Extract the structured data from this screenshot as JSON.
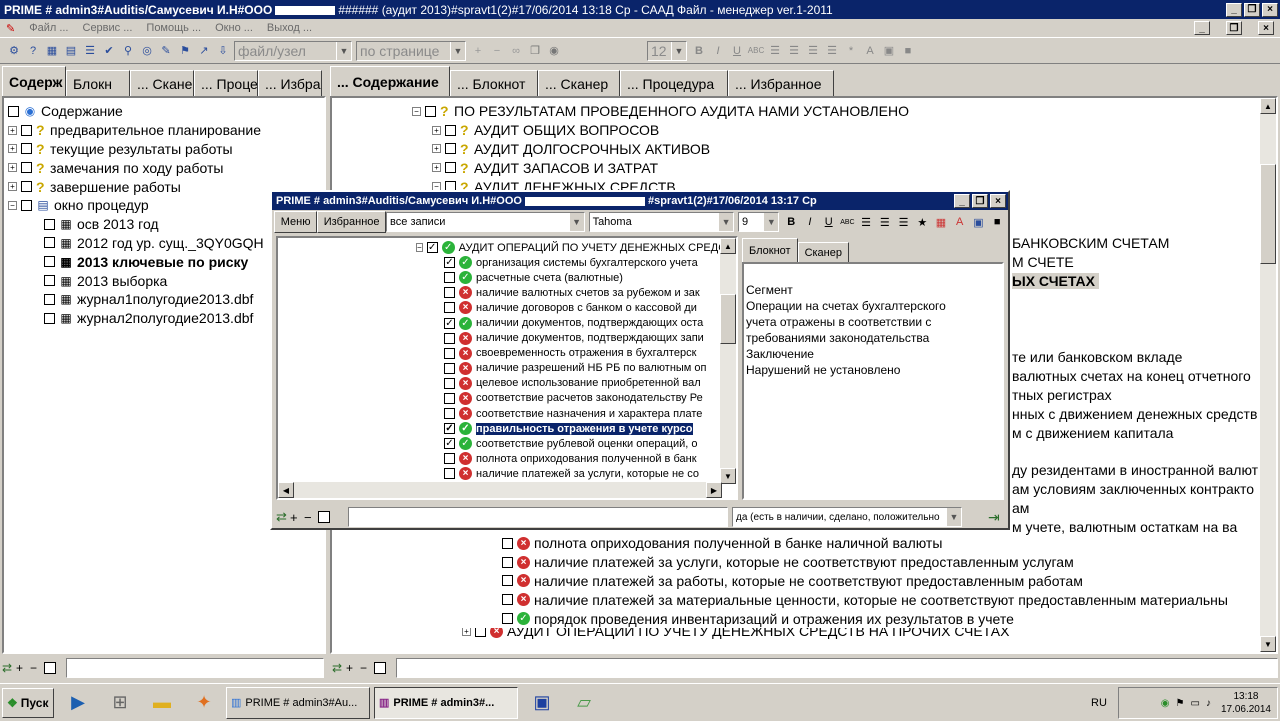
{
  "window": {
    "title": "PRIME # admin3#Auditis/Самусевич И.Н#ООО",
    "title_redacted": "###### (аудит 2013)#spravt1(2)#17/06/2014 13:18 Ср - САAД Файл - менеджер ver.1-2011",
    "controls": [
      "_",
      "❐",
      "×"
    ]
  },
  "menu": [
    "Файл ...",
    "Сервис ...",
    "Помощь ...",
    "Окно ...",
    "Выход ..."
  ],
  "toolbar": {
    "file_combo": "файл/узел",
    "page_combo": "по странице",
    "size_combo": "12"
  },
  "left": {
    "tabs": [
      "Содерж",
      "Блокн",
      "... Сканер",
      "... Проце",
      "... Избран"
    ],
    "root": "Содержание",
    "items": [
      "предварительное планирование",
      "текущие результаты работы",
      "замечания по ходу работы",
      "завершение работы",
      "окно процедур"
    ],
    "sub": [
      "осв 2013 год",
      "2012 год ур. сущ._3QY0GQH",
      "2013 ключевые по риску",
      "2013 выборка",
      "журнал1полугодие2013.dbf",
      "журнал2полугодие2013.dbf"
    ]
  },
  "right": {
    "tabs": [
      "... Содержание",
      "... Блокнот",
      "... Сканер",
      "... Процедура",
      "... Избранное"
    ],
    "top_lines": [
      "ПО РЕЗУЛЬТАТАМ ПРОВЕДЕННОГО АУДИТА НАМИ УСТАНОВЛЕНО",
      "АУДИТ ОБЩИХ ВОПРОСОВ",
      "АУДИТ ДОЛГОСРОЧНЫХ АКТИВОВ",
      "АУДИТ ЗАПАСОВ И ЗАТРАТ",
      "АУДИТ ДЕНЕЖНЫХ СРЕДСТВ"
    ],
    "right_fragments": [
      "БАНКОВСКИМ СЧЕТАМ",
      "М СЧЕТЕ",
      "ЫХ СЧЕТАХ",
      "те или банковском вкладе",
      "валютных счетах на конец отчетного",
      "тных регистрах",
      "нных с движением денежных средств",
      "м с движением капитала",
      "ду резидентами в иностранной валют",
      "ам условиям заключенных контракто",
      "ам",
      "м учете,  валютным остаткам на ва"
    ],
    "bottom_lines": [
      "полнота оприходования полученной в банке наличной валюты",
      "наличие платежей за услуги, которые не соответствуют предоставленным услугам",
      "наличие платежей за работы, которые не соответствуют предоставленным работам",
      "наличие платежей за материальные ценности, которые не соответствуют предоставленным материальны",
      "порядок проведения инвентаризаций и отражения их результатов в учете",
      "АУДИТ ОПЕРАЦИЙ ПО УЧЕТУ ДЕНЕЖНЫХ СРЕДСТВ НА ПРОЧИХ СЧЕТАХ"
    ]
  },
  "dialog": {
    "title": "PRIME # admin3#Auditis/Самусевич И.Н#ООО",
    "title_rest": "#spravt1(2)#17/06/2014 13:17 Ср",
    "menu_btn": "Меню",
    "fav_btn": "Избранное",
    "filter_combo": "все записи",
    "font_combo": "Tahoma",
    "size_combo": "9",
    "header": "АУДИТ ОПЕРАЦИЙ ПО УЧЕТУ ДЕНЕЖНЫХ СРЕДС",
    "items": [
      {
        "text": "организация системы бухгалтерского учета",
        "status": "ok",
        "checked": true
      },
      {
        "text": "расчетные счета (валютные)",
        "status": "ok",
        "checked": false
      },
      {
        "text": "наличие валютных счетов за рубежом и зак",
        "status": "no",
        "checked": false
      },
      {
        "text": "наличие договоров с банком о кассовой ди",
        "status": "no",
        "checked": false
      },
      {
        "text": "наличии документов, подтверждающих оста",
        "status": "ok",
        "checked": true
      },
      {
        "text": "наличие документов, подтверждающих запи",
        "status": "no",
        "checked": false
      },
      {
        "text": "своевременность отражения в бухгалтерск",
        "status": "no",
        "checked": false
      },
      {
        "text": "наличие разрешений НБ РБ по валютным оп",
        "status": "no",
        "checked": false
      },
      {
        "text": "целевое использование приобретенной вал",
        "status": "no",
        "checked": false
      },
      {
        "text": "соответствие расчетов законодательству Ре",
        "status": "no",
        "checked": false
      },
      {
        "text": "соответствие назначения и характера плате",
        "status": "no",
        "checked": false
      },
      {
        "text": "правильность отражения в учете курсо",
        "status": "ok",
        "checked": true
      },
      {
        "text": "соответствие рублевой оценки операций, о",
        "status": "ok",
        "checked": true
      },
      {
        "text": "полнота оприходования полученной в банк",
        "status": "no",
        "checked": false
      },
      {
        "text": "наличие платежей за услуги, которые не со",
        "status": "no",
        "checked": false
      }
    ],
    "right_tabs": [
      "Блокнот",
      "Сканер"
    ],
    "note_lines": [
      "Сегмент",
      "Операции на счетах бухгалтерского",
      "учета отражены в соответствии с",
      "требованиями законодательства",
      "Заключение",
      "Нарушений не установлено"
    ],
    "answer_combo": "да (есть в наличии, сделано, положительно"
  },
  "taskbar": {
    "start": "Пуск",
    "tasks": [
      "PRIME # admin3#Au...",
      "PRIME # admin3#..."
    ],
    "lang": "RU",
    "time": "13:18",
    "date": "17.06.2014"
  },
  "colors": {
    "titlebar": "#0a246a",
    "face": "#d4d0c8",
    "ok": "#2bb33a",
    "error": "#d03030"
  }
}
